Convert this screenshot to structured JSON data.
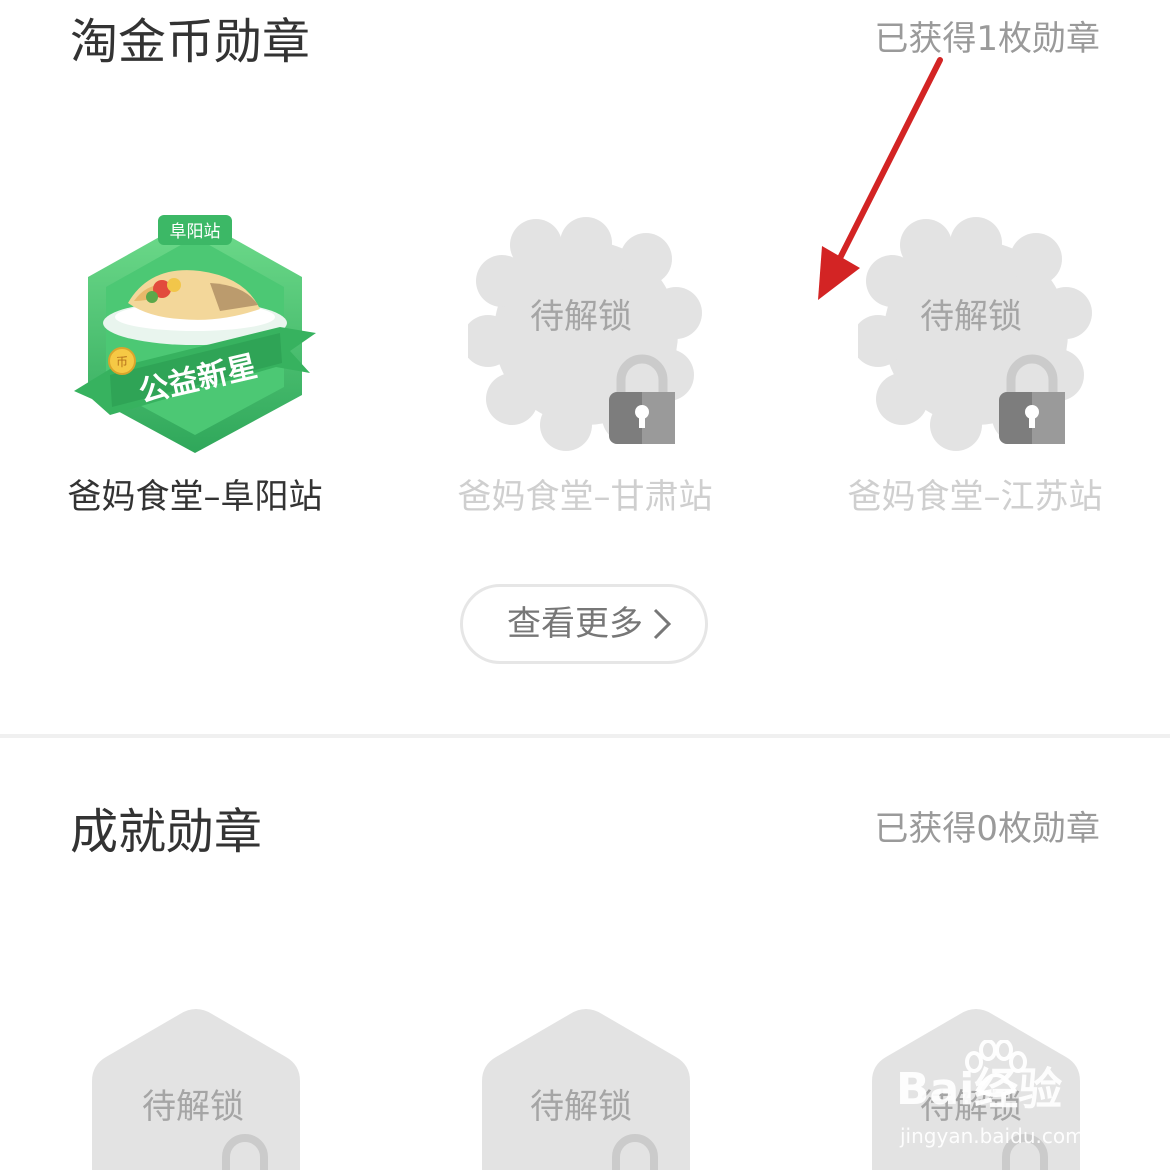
{
  "taojin_section": {
    "title": "淘金币勋章",
    "count_text": "已获得1枚勋章",
    "badges": [
      {
        "name": "爸妈食堂–阜阳站",
        "earned": true,
        "ribbon_top": "阜阳站",
        "ribbon_bottom": "公益新星",
        "coin_mark": "币"
      },
      {
        "name": "爸妈食堂–甘肃站",
        "earned": false,
        "label": "待解锁"
      },
      {
        "name": "爸妈食堂–江苏站",
        "earned": false,
        "label": "待解锁"
      }
    ],
    "more_button": "查看更多"
  },
  "achievement_section": {
    "title": "成就勋章",
    "count_text": "已获得0枚勋章",
    "badges": [
      {
        "label": "待解锁",
        "earned": false
      },
      {
        "label": "待解锁",
        "earned": false
      },
      {
        "label": "待解锁",
        "earned": false
      }
    ]
  },
  "annotation": {
    "arrow_color": "#d32424"
  },
  "watermark": {
    "main": "Bai经验",
    "sub": "jingyan.baidu.com"
  },
  "colors": {
    "badge_green": "#3fbf6a",
    "locked_gray": "#e3e3e3",
    "lock_gray": "#7d7d7d"
  }
}
